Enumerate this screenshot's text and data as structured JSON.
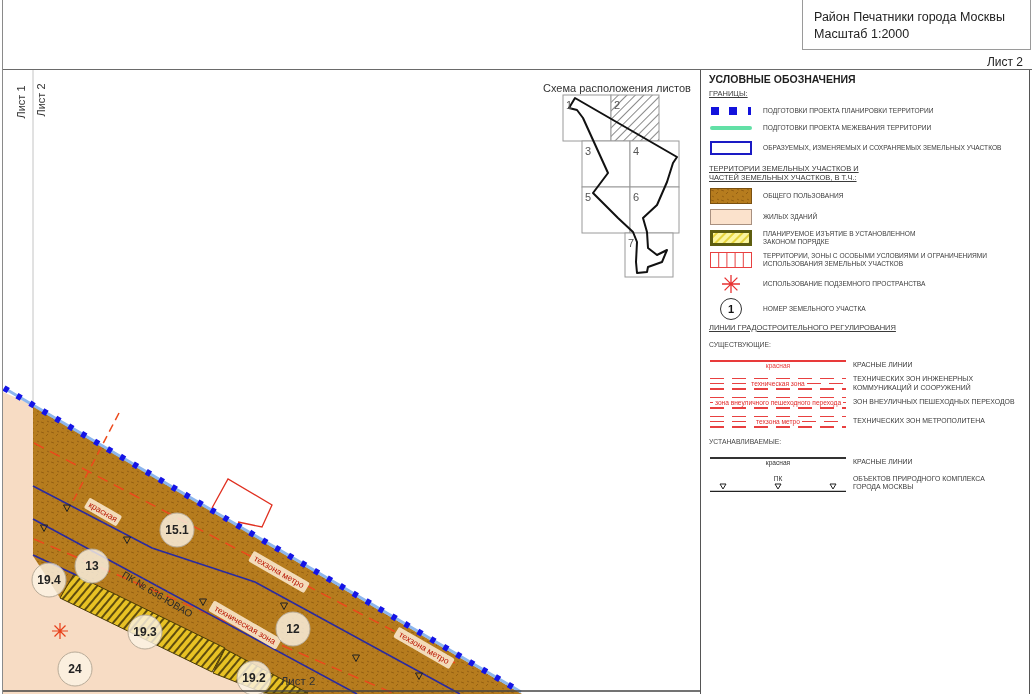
{
  "header": {
    "title": "Район Печатники города Москвы",
    "scale": "Масштаб 1:2000",
    "sheet": "Лист 2"
  },
  "margin_labels": [
    "Лист 1",
    "Лист 2"
  ],
  "sheet_scheme": {
    "title": "Схема расположения листов",
    "sheets": [
      {
        "number": "1",
        "selected": false
      },
      {
        "number": "2",
        "selected": true
      },
      {
        "number": "3",
        "selected": false
      },
      {
        "number": "4",
        "selected": false
      },
      {
        "number": "5",
        "selected": false
      },
      {
        "number": "6",
        "selected": false
      },
      {
        "number": "7",
        "selected": false
      }
    ]
  },
  "map": {
    "parcels": [
      "15.1",
      "13",
      "19.4",
      "12",
      "19.3",
      "24",
      "19.2"
    ],
    "route_label": "ПК № 636-ЮВАО",
    "captions": [
      "красная",
      "техзона метро",
      "техническая зона",
      "техзона метро"
    ],
    "sheet_label": "Лист 2"
  },
  "legend": {
    "title": "УСЛОВНЫЕ ОБОЗНАЧЕНИЯ",
    "entries": [
      {
        "kind": "heading",
        "text": "ГРАНИЦЫ:"
      },
      {
        "kind": "planning-boundary",
        "text": "ПОДГОТОВКИ ПРОЕКТА ПЛАНИРОВКИ ТЕРРИТОРИИ"
      },
      {
        "kind": "survey-boundary",
        "text": "ПОДГОТОВКИ ПРОЕКТА МЕЖЕВАНИЯ ТЕРРИТОРИИ"
      },
      {
        "kind": "parcel-boundary",
        "text": "ОБРАЗУЕМЫХ, ИЗМЕНЯЕМЫХ И СОХРАНЯЕМЫХ ЗЕМЕЛЬНЫХ УЧАСТКОВ"
      },
      {
        "kind": "heading",
        "lines": [
          "ТЕРРИТОРИИ ЗЕМЕЛЬНЫХ УЧАСТКОВ И",
          "ЧАСТЕЙ ЗЕМЕЛЬНЫХ УЧАСТКОВ, В Т.Ч.:"
        ]
      },
      {
        "kind": "common-use",
        "text": "ОБЩЕГО ПОЛЬЗОВАНИЯ"
      },
      {
        "kind": "residential",
        "text": "ЖИЛЫХ ЗДАНИЙ"
      },
      {
        "kind": "withdrawal",
        "lines": [
          "ПЛАНИРУЕМОЕ ИЗЪЯТИЕ В УСТАНОВЛЕННОМ",
          "ЗАКОНОМ ПОРЯДКЕ"
        ]
      },
      {
        "kind": "restricted",
        "lines": [
          "ТЕРРИТОРИИ, ЗОНЫ С ОСОБЫМИ УСЛОВИЯМИ И ОГРАНИЧЕНИЯМИ",
          "ИСПОЛЬЗОВАНИЯ ЗЕМЕЛЬНЫХ УЧАСТКОВ"
        ]
      },
      {
        "kind": "underground",
        "text": "ИСПОЛЬЗОВАНИЕ ПОДЗЕМНОГО ПРОСТРАНСТВА"
      },
      {
        "kind": "parcel-number",
        "sample": "1",
        "text": "НОМЕР ЗЕМЕЛЬНОГО УЧАСТКА"
      },
      {
        "kind": "heading",
        "text": "ЛИНИИ ГРАДОСТРОИТЕЛЬНОГО РЕГУЛИРОВАНИЯ"
      },
      {
        "kind": "subheading",
        "text": "СУЩЕСТВУЮЩИЕ:"
      },
      {
        "kind": "solid-line",
        "color": "#e83a3a",
        "caption": "красная",
        "text": "КРАСНЫЕ ЛИНИИ"
      },
      {
        "kind": "dashed-lines",
        "caption": "техническая зона",
        "lines": [
          "ТЕХНИЧЕСКИХ ЗОН ИНЖЕНЕРНЫХ",
          "КОММУНИКАЦИЙ И СООРУЖЕНИЙ"
        ]
      },
      {
        "kind": "dashed-lines",
        "caption": "зона внеуличного пешеходного перехода",
        "text": "ЗОН ВНЕУЛИЧНЫХ ПЕШЕХОДНЫХ ПЕРЕХОДОВ"
      },
      {
        "kind": "dashed-lines",
        "caption": "техзона метро",
        "text": "ТЕХНИЧЕСКИХ ЗОН МЕТРОПОЛИТЕНА"
      },
      {
        "kind": "subheading",
        "text": "УСТАНАВЛИВАЕМЫЕ:"
      },
      {
        "kind": "solid-line",
        "color": "#333333",
        "caption": "красная",
        "text": "КРАСНЫЕ ЛИНИИ"
      },
      {
        "kind": "marker-line",
        "caption": "ПК",
        "lines": [
          "ОБЪЕКТОВ ПРИРОДНОГО КОМПЛЕКСА",
          "ГОРОДА МОСКВЫ"
        ]
      }
    ]
  }
}
